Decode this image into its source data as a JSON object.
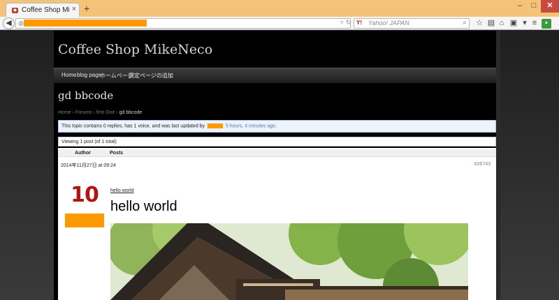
{
  "browser": {
    "tab": {
      "title": "Coffee Shop MikeNeco |…",
      "close": "×"
    },
    "new_tab": "+",
    "window_buttons": {
      "minimize": "–",
      "maximize": "□",
      "close": "✕"
    },
    "search": {
      "placeholder": "Yahoo! JAPAN",
      "engine": "Y!"
    },
    "icons": [
      "back-icon",
      "star-icon",
      "clipboard-icon",
      "home-icon",
      "notes-icon",
      "menu-icon",
      "addon-icon"
    ]
  },
  "site": {
    "title": "Coffee Shop MikeNeco",
    "nav": [
      "Home",
      "blog page",
      "ホームページ",
      "固定ページの追加"
    ]
  },
  "topic": {
    "title": "gd bbcode",
    "breadcrumb": {
      "home": "Home",
      "forums": "Forums",
      "forum": "first One",
      "current": "gd bbcode",
      "sep": "›"
    },
    "notice_prefix": "This topic contains 0 replies, has 1 voice, and was last updated by",
    "notice_time": "5 hours, 4 minutes ago.",
    "viewing": "Viewing 1 post (of 1 total)"
  },
  "table": {
    "col_author": "Author",
    "col_posts": "Posts"
  },
  "post": {
    "date": "2014年11月27日 at 09:24",
    "id": "#26743",
    "avatar_number": "10",
    "link": "hello world",
    "heading": "hello world"
  },
  "colors": {
    "redaction": "#ff9900",
    "avatar_red": "#b11515"
  }
}
